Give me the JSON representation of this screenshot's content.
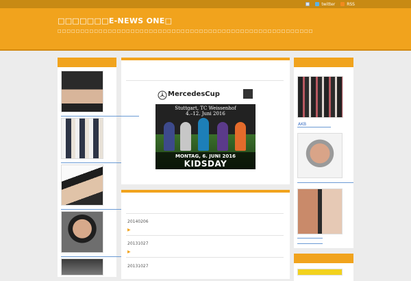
{
  "header": {
    "title": "□□□□□□□E-NEWS ONE□",
    "description": "□□□□□□□□□□□□□□□□□□□□□□□□□□□□□□□□□□□□□□□□□□□□□□□□□□□□□□□□"
  },
  "topbar": {
    "links": [
      {
        "label": "",
        "icon": "home-icon"
      },
      {
        "label": "twitter",
        "icon": "twitter-icon"
      },
      {
        "label": "RSS",
        "icon": "rss-icon"
      }
    ]
  },
  "ad": {
    "brand": "MercedesCup",
    "sub1": "Stuttgart, TC Weissenhof",
    "sub2": "4.–12. Juni 2016",
    "banner_line1": "MONTAG, 6. JUNI 2016",
    "banner_line2": "KIDSDAY"
  },
  "posts": [
    {
      "date": "20140206",
      "arrow": "▶"
    },
    {
      "date": "20131027",
      "arrow": "▶"
    },
    {
      "date": "20131027",
      "arrow": ""
    }
  ],
  "right": {
    "label1": "AKB"
  },
  "colors": {
    "accent": "#f1a31d",
    "topbar": "#c88a14",
    "link": "#3a6fc4"
  }
}
